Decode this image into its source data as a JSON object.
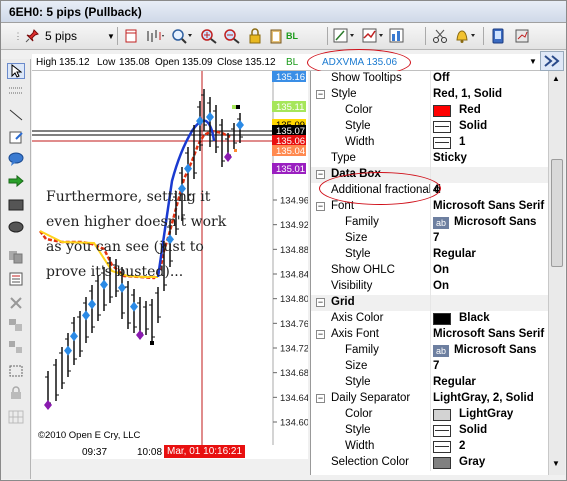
{
  "window": {
    "title": "6EH0: 5 pips (Pullback)"
  },
  "toolbar": {
    "interval": "5 pips"
  },
  "infobar": {
    "high_label": "High",
    "high": "135.12",
    "low_label": "Low",
    "low": "135.08",
    "open_label": "Open",
    "open": "135.09",
    "close_label": "Close",
    "close": "135.12",
    "bl_label": "BL",
    "indicator": "ADXVMA 135.06"
  },
  "chart": {
    "annotation": "Furthermore, setting it even higher doesn't work as you can see (just to prove it's busted)...",
    "copyright": "©2010 Open E Cry, LLC",
    "crosshair_time": "Mar, 01 10:16:21",
    "y_ticks": [
      "134.96",
      "134.92",
      "134.88",
      "134.84",
      "134.80",
      "134.76",
      "134.72",
      "134.68",
      "134.64",
      "134.60"
    ],
    "x_ticks": [
      "09:37",
      "10:08"
    ],
    "price_tags": [
      {
        "value": "135.16",
        "bg": "#3a8ee6",
        "fg": "#ffffff"
      },
      {
        "value": "135.11",
        "bg": "#a6e65a",
        "fg": "#ffffff"
      },
      {
        "value": "135.09",
        "bg": "#ffd700",
        "fg": "#000000"
      },
      {
        "value": "135.07",
        "bg": "#000000",
        "fg": "#ffffff"
      },
      {
        "value": "135.06",
        "bg": "#e81010",
        "fg": "#ffffff"
      },
      {
        "value": "135.04",
        "bg": "#ff8a50",
        "fg": "#ffffff"
      },
      {
        "value": "135.01",
        "bg": "#9a1fc0",
        "fg": "#ffffff"
      }
    ]
  },
  "properties": [
    {
      "type": "prop",
      "indent": 1,
      "name": "Show Tooltips",
      "value": "Off"
    },
    {
      "type": "group",
      "name": "Style",
      "value": "Red, 1, Solid"
    },
    {
      "type": "prop",
      "indent": 2,
      "name": "Color",
      "value": "Red",
      "swatch": "#ff0000"
    },
    {
      "type": "prop",
      "indent": 2,
      "name": "Style",
      "value": "Solid",
      "line": true
    },
    {
      "type": "prop",
      "indent": 2,
      "name": "Width",
      "value": "1",
      "line": true
    },
    {
      "type": "prop",
      "indent": 1,
      "name": "Type",
      "value": "Sticky"
    },
    {
      "type": "cat",
      "name": "Data Box"
    },
    {
      "type": "prop",
      "indent": 1,
      "name": "Additional fractional d",
      "value": "4"
    },
    {
      "type": "group",
      "name": "Font",
      "value": "Microsoft Sans Serif"
    },
    {
      "type": "prop",
      "indent": 2,
      "name": "Family",
      "value": "Microsoft Sans",
      "ab": true
    },
    {
      "type": "prop",
      "indent": 2,
      "name": "Size",
      "value": "7"
    },
    {
      "type": "prop",
      "indent": 2,
      "name": "Style",
      "value": "Regular"
    },
    {
      "type": "prop",
      "indent": 1,
      "name": "Show OHLC",
      "value": "On"
    },
    {
      "type": "prop",
      "indent": 1,
      "name": "Visibility",
      "value": "On"
    },
    {
      "type": "cat",
      "name": "Grid"
    },
    {
      "type": "prop",
      "indent": 1,
      "name": "Axis Color",
      "value": "Black",
      "swatch": "#000000"
    },
    {
      "type": "group",
      "name": "Axis Font",
      "value": "Microsoft Sans Serif"
    },
    {
      "type": "prop",
      "indent": 2,
      "name": "Family",
      "value": "Microsoft Sans",
      "ab": true
    },
    {
      "type": "prop",
      "indent": 2,
      "name": "Size",
      "value": "7"
    },
    {
      "type": "prop",
      "indent": 2,
      "name": "Style",
      "value": "Regular"
    },
    {
      "type": "group",
      "name": "Daily Separator",
      "value": "LightGray, 2, Solid"
    },
    {
      "type": "prop",
      "indent": 2,
      "name": "Color",
      "value": "LightGray",
      "swatch": "#d3d3d3"
    },
    {
      "type": "prop",
      "indent": 2,
      "name": "Style",
      "value": "Solid",
      "line": true
    },
    {
      "type": "prop",
      "indent": 2,
      "name": "Width",
      "value": "2",
      "line": true
    },
    {
      "type": "prop",
      "indent": 1,
      "name": "Selection Color",
      "value": "Gray",
      "swatch": "#808080"
    }
  ]
}
